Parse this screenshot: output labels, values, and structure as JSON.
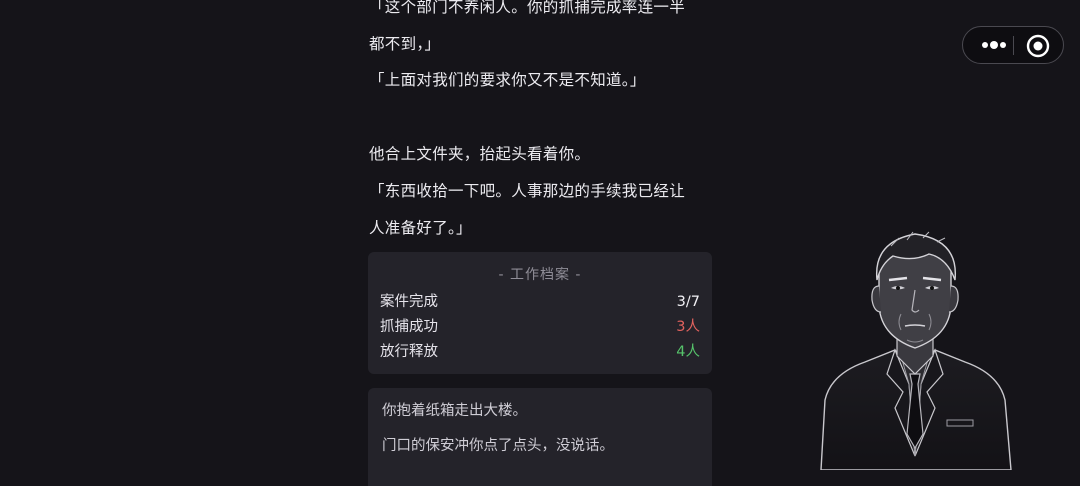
{
  "story": {
    "lines": [
      "「这个部门不养闲人。你的抓捕完成率连一半",
      "都不到，」",
      "「上面对我们的要求你又不是不知道。」",
      "他合上文件夹，抬起头看着你。",
      "「东西收拾一下吧。人事那边的手续我已经让",
      "人准备好了。」"
    ]
  },
  "work_file": {
    "title": "- 工作档案 -",
    "rows": [
      {
        "label": "案件完成",
        "value": "3/7",
        "color": "#f2f1f5"
      },
      {
        "label": "抓捕成功",
        "value": "3人",
        "color": "#e0625e"
      },
      {
        "label": "放行释放",
        "value": "4人",
        "color": "#56c46b"
      }
    ]
  },
  "ending_note": {
    "lines": [
      "你抱着纸箱走出大楼。",
      "门口的保安冲你点了点头，没说话。"
    ]
  },
  "capsule": {
    "more_icon": "more-dots-icon",
    "close_icon": "close-target-icon"
  },
  "character": {
    "icon": "supervisor-portrait"
  }
}
